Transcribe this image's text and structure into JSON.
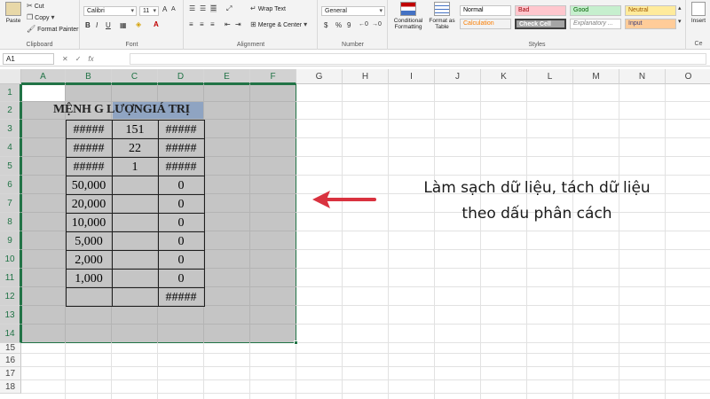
{
  "ribbon": {
    "clipboard": {
      "paste": "Paste",
      "cut": "Cut",
      "copy": "Copy",
      "format_painter": "Format Painter",
      "label": "Clipboard"
    },
    "font": {
      "name": "Calibri",
      "size": "11",
      "bold": "B",
      "italic": "I",
      "underline": "U",
      "label": "Font"
    },
    "alignment": {
      "wrap_text": "Wrap Text",
      "merge_center": "Merge & Center",
      "label": "Alignment"
    },
    "number": {
      "format": "General",
      "currency": "$",
      "percent": "%",
      "comma": "9",
      "label": "Number"
    },
    "styles": {
      "conditional_formatting": "Conditional Formatting",
      "format_as_table": "Format as Table",
      "cells": [
        {
          "label": "Normal",
          "bg": "#ffffff",
          "fg": "#000000"
        },
        {
          "label": "Bad",
          "bg": "#ffc7ce",
          "fg": "#9c0006"
        },
        {
          "label": "Good",
          "bg": "#c6efce",
          "fg": "#006100"
        },
        {
          "label": "Neutral",
          "bg": "#ffeb9c",
          "fg": "#9c5700"
        },
        {
          "label": "Calculation",
          "bg": "#f2f2f2",
          "fg": "#fa7d00"
        },
        {
          "label": "Check Cell",
          "bg": "#a5a5a5",
          "fg": "#ffffff"
        },
        {
          "label": "Explanatory ...",
          "bg": "#ffffff",
          "fg": "#7f7f7f"
        },
        {
          "label": "Input",
          "bg": "#ffcc99",
          "fg": "#3f3f76"
        }
      ],
      "label": "Styles"
    },
    "insert": "Insert",
    "cells_group": "Ce"
  },
  "formula_bar": {
    "name_box": "A1"
  },
  "grid": {
    "columns": [
      "A",
      "B",
      "C",
      "D",
      "E",
      "F",
      "G",
      "H",
      "I",
      "J",
      "K",
      "L",
      "M",
      "N",
      "O"
    ],
    "rows": [
      "1",
      "2",
      "3",
      "4",
      "5",
      "6",
      "7",
      "8",
      "9",
      "10",
      "11",
      "12",
      "13",
      "14",
      "15",
      "16",
      "17",
      "18"
    ]
  },
  "sheet": {
    "title": "MỆNH G LƯỢNGIÁ TRỊ",
    "table": [
      [
        "#####",
        "151",
        "#####"
      ],
      [
        "#####",
        "22",
        "#####"
      ],
      [
        "#####",
        "1",
        "#####"
      ],
      [
        "50,000",
        "",
        "0"
      ],
      [
        "20,000",
        "",
        "0"
      ],
      [
        "10,000",
        "",
        "0"
      ],
      [
        "5,000",
        "",
        "0"
      ],
      [
        "2,000",
        "",
        "0"
      ],
      [
        "1,000",
        "",
        "0"
      ],
      [
        "",
        "",
        "#####"
      ]
    ]
  },
  "annotation": {
    "line1": "Làm sạch dữ liệu, tách dữ liệu",
    "line2": "theo dấu phân cách",
    "arrow_color": "#d9323f"
  },
  "colors": {
    "selection_border": "#217346",
    "selection_fill": "#c5c5c5",
    "header_highlight": "#8fa4c2"
  }
}
